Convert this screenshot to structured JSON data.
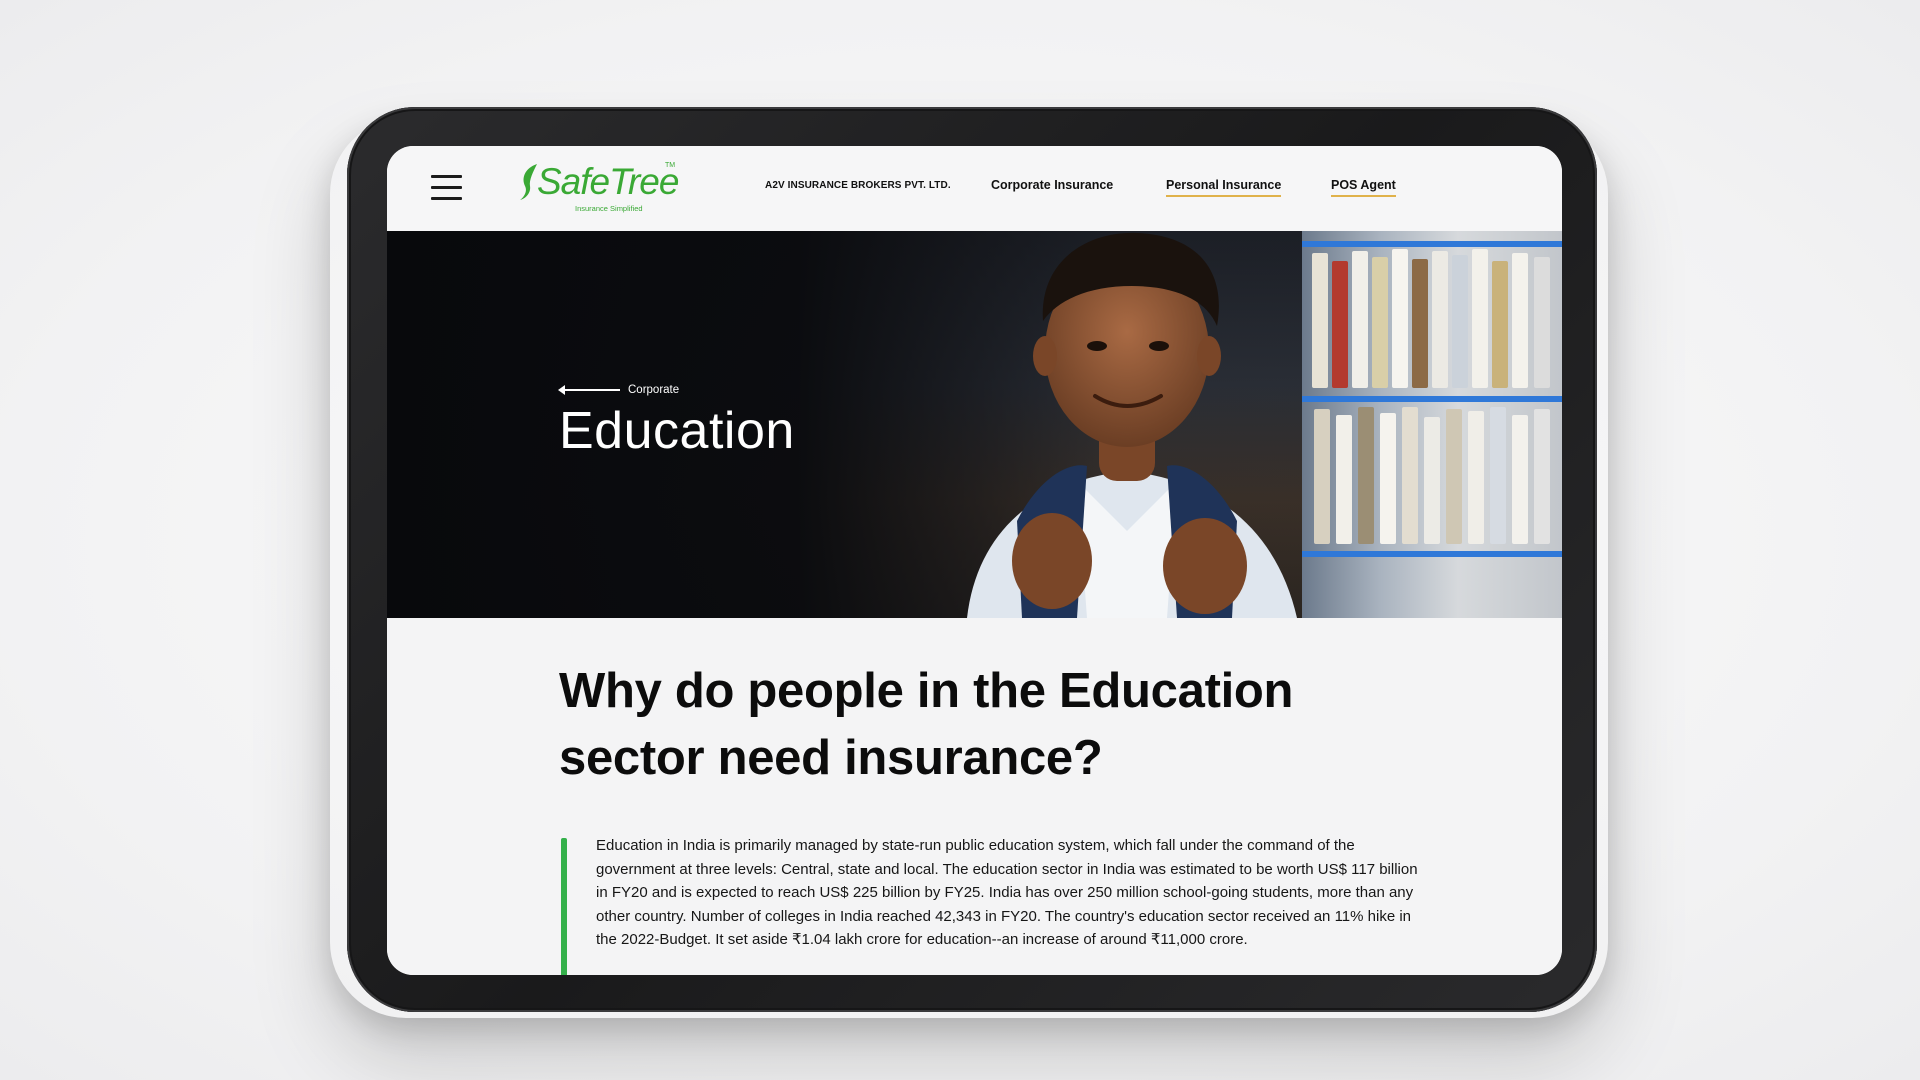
{
  "header": {
    "logo_text": "SafeTree",
    "logo_tm": "TM",
    "logo_tagline": "Insurance Simplified",
    "menu_icon": "hamburger-menu-icon",
    "nav": {
      "company": "A2V INSURANCE BROKERS PVT. LTD.",
      "corporate": "Corporate Insurance",
      "personal": "Personal Insurance",
      "pos": "POS Agent"
    },
    "nav_underline_color": "#e0b24b",
    "brand_color": "#3aa935"
  },
  "hero": {
    "back_label": "Corporate",
    "back_icon": "arrow-left-icon",
    "title": "Education"
  },
  "body": {
    "headline": "Why do people in the Education sector need insurance?",
    "accent_color": "#34b04a",
    "paragraph": "Education in India is primarily managed by state-run public education system, which fall under the command of the government at three levels: Central, state and local. The education sector in India was estimated to be worth US$ 117 billion in FY20 and is expected to reach US$ 225 billion by FY25. India has over 250 million school-going students, more than any other country. Number of colleges in India reached 42,343 in FY20. The country's education sector received an 11% hike in the 2022-Budget. It set aside ₹1.04 lakh crore for education--an increase of around ₹11,000 crore."
  }
}
